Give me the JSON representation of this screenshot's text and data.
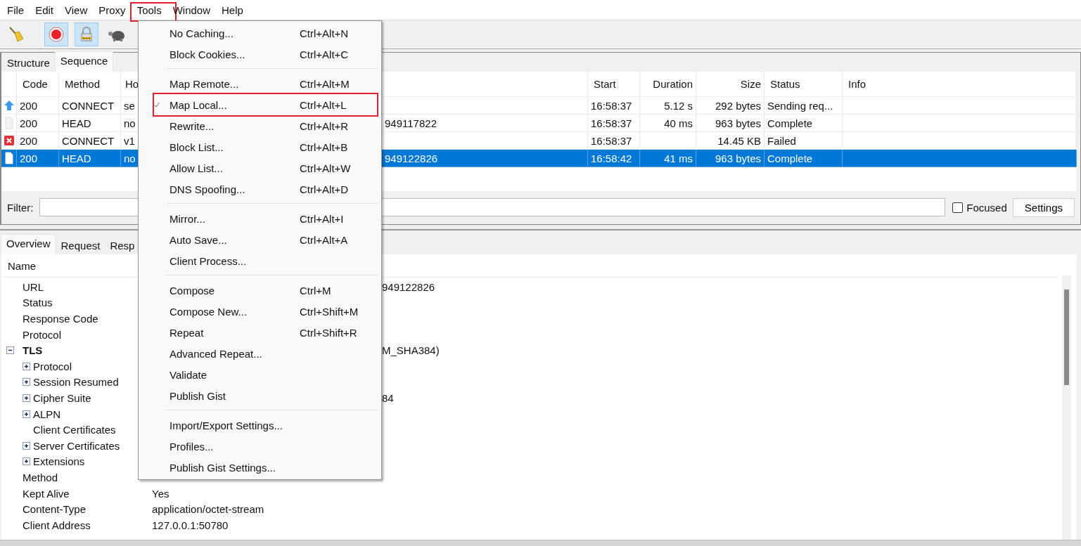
{
  "menubar": [
    {
      "label": "File",
      "highlighted": false
    },
    {
      "label": "Edit",
      "highlighted": false
    },
    {
      "label": "View",
      "highlighted": false
    },
    {
      "label": "Proxy",
      "highlighted": false
    },
    {
      "label": "Tools",
      "highlighted": true
    },
    {
      "label": "Window",
      "highlighted": false
    },
    {
      "label": "Help",
      "highlighted": false
    }
  ],
  "toolbar": [
    {
      "kind": "broom",
      "pressed": false
    },
    {
      "kind": "record",
      "pressed": true
    },
    {
      "kind": "lock",
      "pressed": true
    },
    {
      "kind": "turtle",
      "pressed": false
    }
  ],
  "session_tabs": [
    {
      "label": "Structure",
      "selected": false
    },
    {
      "label": "Sequence",
      "selected": true
    }
  ],
  "table": {
    "columns": {
      "code": "Code",
      "method": "Method",
      "host": "Ho",
      "start": "Start",
      "duration": "Duration",
      "size": "Size",
      "status": "Status",
      "info": "Info"
    },
    "rows": [
      {
        "kind": "upload",
        "code": "200",
        "method": "CONNECT",
        "host": "se",
        "start": "16:58:37",
        "duration": "5.12 s",
        "size": "292 bytes",
        "status": "Sending req...",
        "selected": false
      },
      {
        "kind": "blank",
        "code": "200",
        "method": "HEAD",
        "host": "no",
        "url": "949117822",
        "start": "16:58:37",
        "duration": "40 ms",
        "size": "963 bytes",
        "status": "Complete",
        "selected": false
      },
      {
        "kind": "error",
        "code": "200",
        "method": "CONNECT",
        "host": "v1",
        "start": "16:58:37",
        "size": "14.45 KB",
        "status": "Failed",
        "selected": false
      },
      {
        "kind": "document",
        "code": "200",
        "method": "HEAD",
        "host": "no",
        "url": "949122826",
        "start": "16:58:42",
        "duration": "41 ms",
        "size": "963 bytes",
        "status": "Complete",
        "selected": true
      }
    ]
  },
  "filter": {
    "label": "Filter:",
    "focused": {
      "label": "Focused",
      "checked": false
    },
    "button": "Settings"
  },
  "detail_tabs": [
    {
      "label": "Overview",
      "selected": true
    },
    {
      "label": "Request",
      "selected": false
    },
    {
      "label": "Resp",
      "selected": false
    }
  ],
  "detail": {
    "header": "Name",
    "items": [
      {
        "name": "URL",
        "kind": "leaf",
        "value_tail": "949122826"
      },
      {
        "name": "Status",
        "kind": "leaf"
      },
      {
        "name": "Response Code",
        "kind": "leaf"
      },
      {
        "name": "Protocol",
        "kind": "leaf"
      },
      {
        "name": "TLS",
        "kind": "group",
        "expanded": true,
        "value_tail": "M_SHA384)",
        "children": [
          {
            "name": "Protocol",
            "kind": "group",
            "expanded": false
          },
          {
            "name": "Session Resumed",
            "kind": "group",
            "expanded": false
          },
          {
            "name": "Cipher Suite",
            "kind": "group",
            "expanded": false,
            "value_tail": "84"
          },
          {
            "name": "ALPN",
            "kind": "group",
            "expanded": false
          },
          {
            "name": "Client Certificates",
            "kind": "leaf"
          },
          {
            "name": "Server Certificates",
            "kind": "group",
            "expanded": false
          },
          {
            "name": "Extensions",
            "kind": "group",
            "expanded": false
          }
        ]
      },
      {
        "name": "Method",
        "kind": "leaf"
      },
      {
        "name": "Kept Alive",
        "kind": "leaf",
        "value": "Yes"
      },
      {
        "name": "Content-Type",
        "kind": "leaf",
        "value": "application/octet-stream"
      },
      {
        "name": "Client Address",
        "kind": "leaf",
        "value": "127.0.0.1:50780"
      }
    ]
  },
  "tools_menu": [
    {
      "kind": "item",
      "label": "No Caching...",
      "shortcut": "Ctrl+Alt+N",
      "checked": false,
      "highlighted": false
    },
    {
      "kind": "item",
      "label": "Block Cookies...",
      "shortcut": "Ctrl+Alt+C",
      "checked": false,
      "highlighted": false
    },
    {
      "kind": "separator"
    },
    {
      "kind": "item",
      "label": "Map Remote...",
      "shortcut": "Ctrl+Alt+M",
      "checked": false,
      "highlighted": false
    },
    {
      "kind": "item",
      "label": "Map Local...",
      "shortcut": "Ctrl+Alt+L",
      "checked": true,
      "highlighted": true
    },
    {
      "kind": "item",
      "label": "Rewrite...",
      "shortcut": "Ctrl+Alt+R",
      "checked": false,
      "highlighted": false
    },
    {
      "kind": "item",
      "label": "Block List...",
      "shortcut": "Ctrl+Alt+B",
      "checked": false,
      "highlighted": false
    },
    {
      "kind": "item",
      "label": "Allow List...",
      "shortcut": "Ctrl+Alt+W",
      "checked": false,
      "highlighted": false
    },
    {
      "kind": "item",
      "label": "DNS Spoofing...",
      "shortcut": "Ctrl+Alt+D",
      "checked": false,
      "highlighted": false
    },
    {
      "kind": "separator"
    },
    {
      "kind": "item",
      "label": "Mirror...",
      "shortcut": "Ctrl+Alt+I",
      "checked": false,
      "highlighted": false
    },
    {
      "kind": "item",
      "label": "Auto Save...",
      "shortcut": "Ctrl+Alt+A",
      "checked": false,
      "highlighted": false
    },
    {
      "kind": "item",
      "label": "Client Process...",
      "checked": false,
      "highlighted": false
    },
    {
      "kind": "separator"
    },
    {
      "kind": "item",
      "label": "Compose",
      "shortcut": "Ctrl+M",
      "checked": false,
      "highlighted": false
    },
    {
      "kind": "item",
      "label": "Compose New...",
      "shortcut": "Ctrl+Shift+M",
      "checked": false,
      "highlighted": false
    },
    {
      "kind": "item",
      "label": "Repeat",
      "shortcut": "Ctrl+Shift+R",
      "checked": false,
      "highlighted": false
    },
    {
      "kind": "item",
      "label": "Advanced Repeat...",
      "checked": false,
      "highlighted": false
    },
    {
      "kind": "item",
      "label": "Validate",
      "checked": false,
      "highlighted": false
    },
    {
      "kind": "item",
      "label": "Publish Gist",
      "checked": false,
      "highlighted": false
    },
    {
      "kind": "separator"
    },
    {
      "kind": "item",
      "label": "Import/Export Settings...",
      "checked": false,
      "highlighted": false
    },
    {
      "kind": "item",
      "label": "Profiles...",
      "checked": false,
      "highlighted": false
    },
    {
      "kind": "item",
      "label": "Publish Gist Settings...",
      "checked": false,
      "highlighted": false
    }
  ]
}
